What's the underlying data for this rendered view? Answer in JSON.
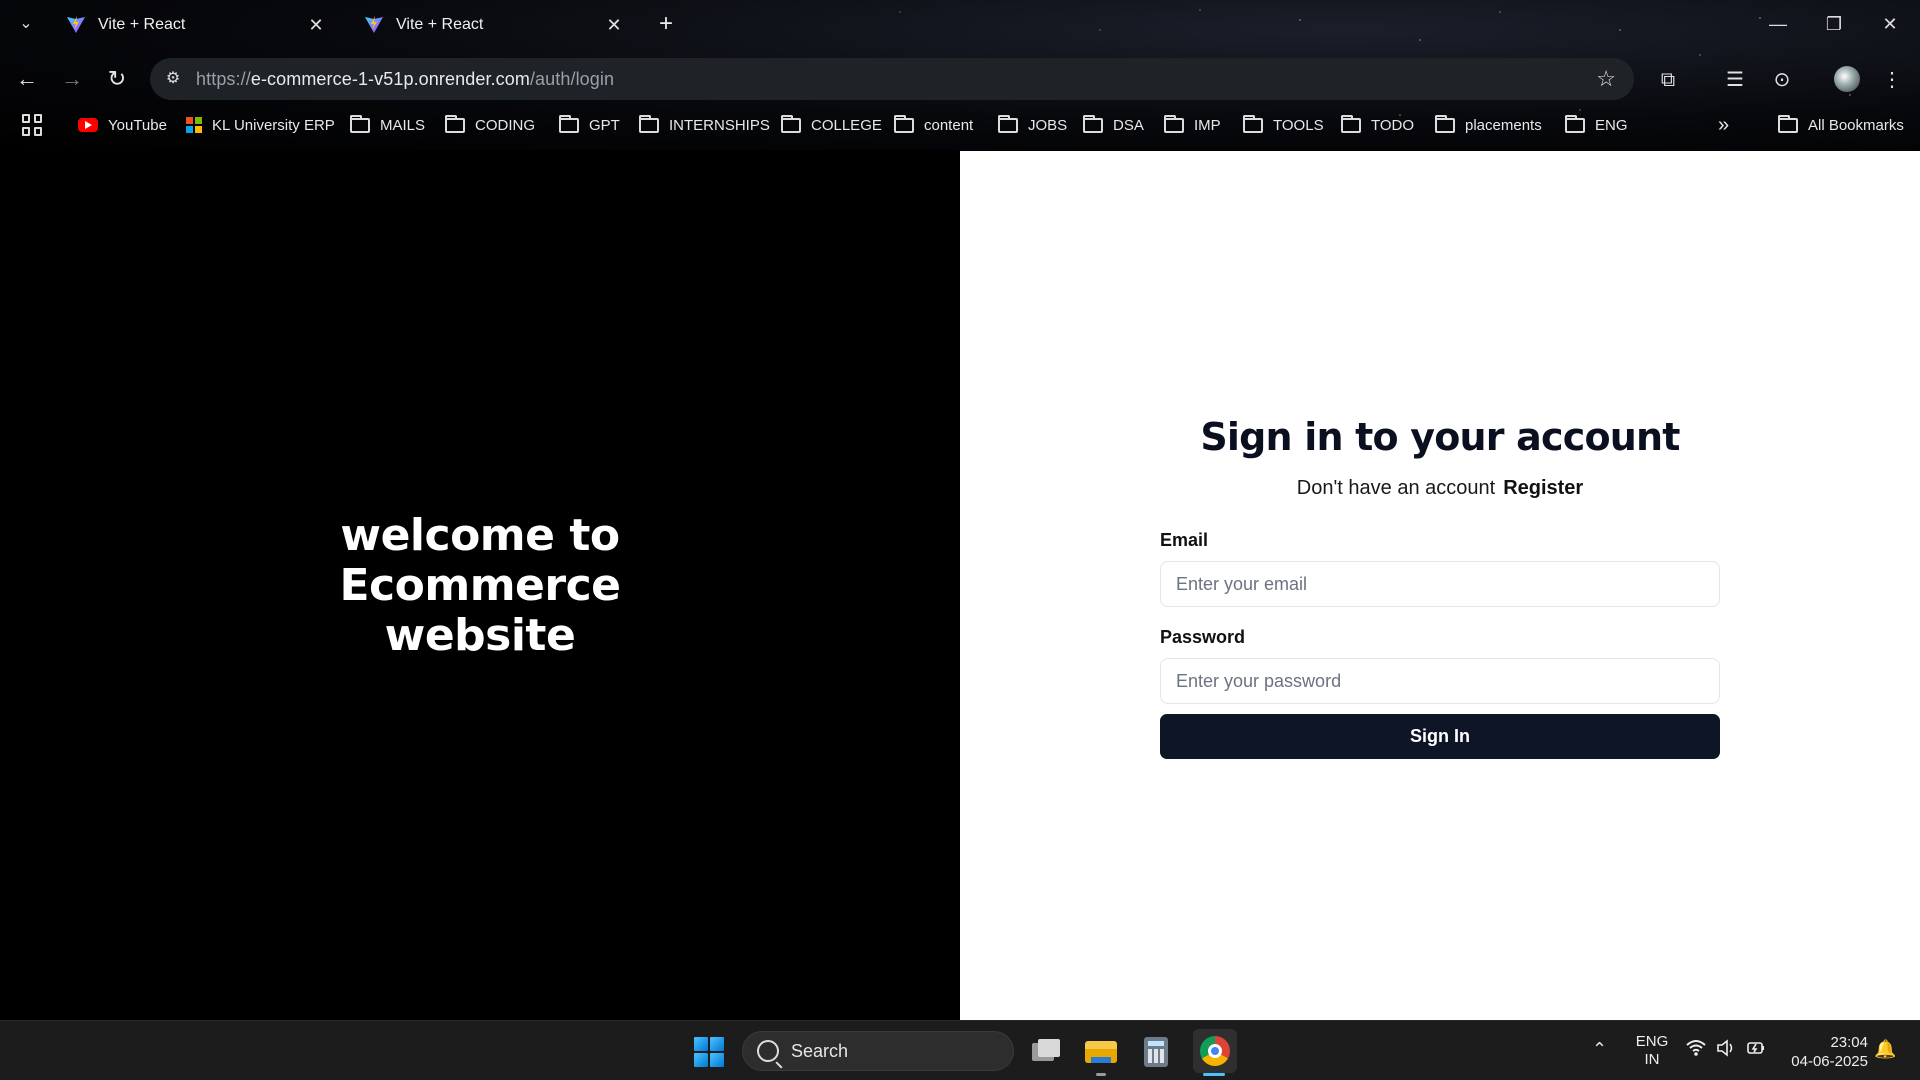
{
  "browser": {
    "tabs": [
      {
        "title": "Vite + React"
      },
      {
        "title": "Vite + React"
      }
    ],
    "url_prefix": "https://",
    "url_host": "e-commerce-1-v51p.onrender.com",
    "url_path": "/auth/login",
    "bookmarks": [
      {
        "label": "YouTube",
        "icon": "youtube-icon"
      },
      {
        "label": "KL University ERP",
        "icon": "microsoft-icon"
      },
      {
        "label": "MAILS",
        "icon": "folder-icon"
      },
      {
        "label": "CODING",
        "icon": "folder-icon"
      },
      {
        "label": "GPT",
        "icon": "folder-icon"
      },
      {
        "label": "INTERNSHIPS",
        "icon": "folder-icon"
      },
      {
        "label": "COLLEGE",
        "icon": "folder-icon"
      },
      {
        "label": "content",
        "icon": "folder-icon"
      },
      {
        "label": "JOBS",
        "icon": "folder-icon"
      },
      {
        "label": "DSA",
        "icon": "folder-icon"
      },
      {
        "label": "IMP",
        "icon": "folder-icon"
      },
      {
        "label": "TOOLS",
        "icon": "folder-icon"
      },
      {
        "label": "TODO",
        "icon": "folder-icon"
      },
      {
        "label": "placements",
        "icon": "folder-icon"
      },
      {
        "label": "ENG",
        "icon": "folder-icon"
      }
    ],
    "more_bookmarks": "»",
    "all_bookmarks": "All Bookmarks"
  },
  "page": {
    "welcome_line1": "welcome to Ecommerce",
    "welcome_line2": "website",
    "signin_title": "Sign in to your account",
    "no_account_text": "Don't have an account",
    "register_link": "Register",
    "email_label": "Email",
    "email_placeholder": "Enter your email",
    "password_label": "Password",
    "password_placeholder": "Enter your password",
    "signin_button": "Sign In"
  },
  "taskbar": {
    "search_label": "Search",
    "lang_line1": "ENG",
    "lang_line2": "IN",
    "time": "23:04",
    "date": "04-06-2025"
  },
  "colors": {
    "button_bg": "#0d1526",
    "left_pane_bg": "#000000",
    "right_pane_bg": "#ffffff"
  }
}
